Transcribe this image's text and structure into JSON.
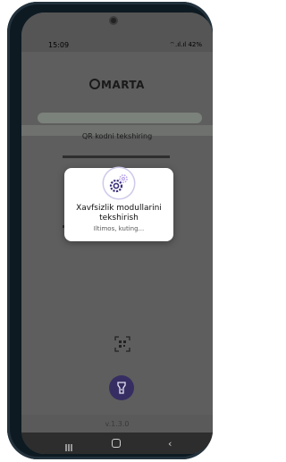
{
  "status": {
    "time": "15:09",
    "indicators": "⌔.ıl.ıl 42%"
  },
  "app": {
    "logo": "MARTA",
    "qr_title": "QR kodni tekshiring",
    "version": "v.1.3.0"
  },
  "dialog": {
    "title": "Xavfsizlik modullarini tekshirish",
    "subtitle": "Iltimos, kuting..."
  },
  "colors": {
    "accent": "#3b2f7a",
    "overlay": "#5a5a5a"
  }
}
